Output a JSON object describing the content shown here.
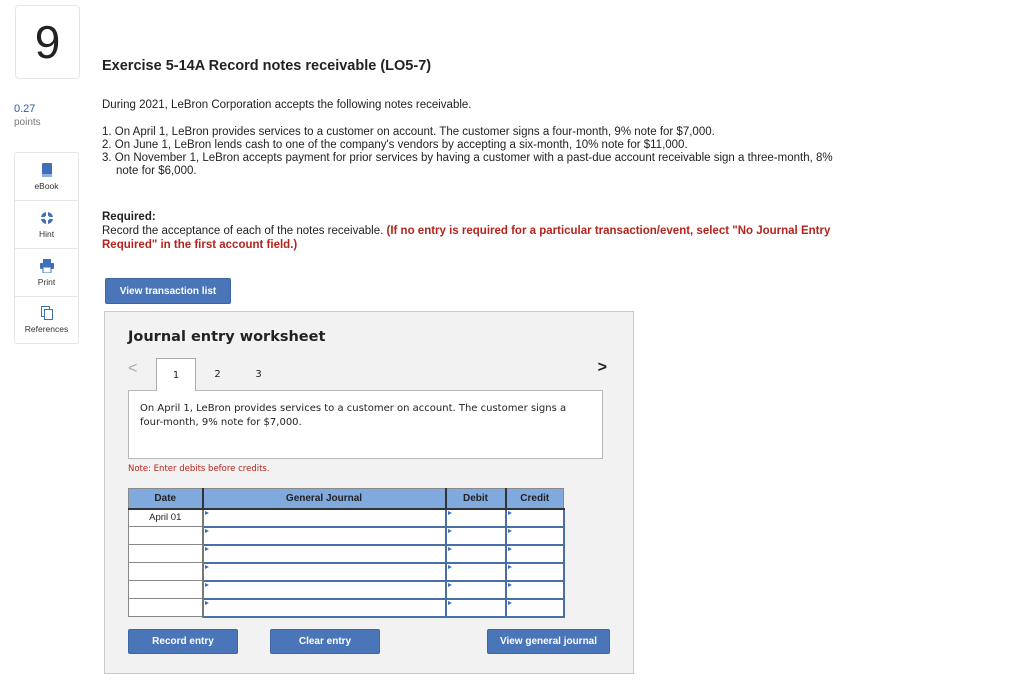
{
  "question": {
    "number": "9",
    "points_value": "0.27",
    "points_label": "points"
  },
  "tools": [
    {
      "label": "eBook",
      "icon": "book-icon"
    },
    {
      "label": "Hint",
      "icon": "lifebuoy-icon"
    },
    {
      "label": "Print",
      "icon": "printer-icon"
    },
    {
      "label": "References",
      "icon": "documents-icon"
    }
  ],
  "exercise": {
    "title": "Exercise 5-14A Record notes receivable (LO5-7)",
    "intro": "During 2021, LeBron Corporation accepts the following notes receivable.",
    "items": [
      "1. On April 1, LeBron provides services to a customer on account. The customer signs a four-month, 9% note for $7,000.",
      "2. On June 1, LeBron lends cash to one of the company's vendors by accepting a six-month, 10% note for $11,000.",
      "3. On November 1, LeBron accepts payment for prior services by having a customer with a past-due account receivable sign a three-month, 8% note for $6,000."
    ],
    "required_heading": "Required:",
    "required_text": "Record the acceptance of each of the notes receivable. ",
    "required_instruction": "(If no entry is required for a particular transaction/event, select \"No Journal Entry Required\" in the first account field.)",
    "view_transaction_list": "View transaction list"
  },
  "worksheet": {
    "title": "Journal entry worksheet",
    "prev_icon": "<",
    "next_icon": ">",
    "tabs": [
      "1",
      "2",
      "3"
    ],
    "active_tab": "1",
    "description": "On April 1, LeBron provides services to a customer on account. The customer signs a four-month, 9% note for $7,000.",
    "note": "Note: Enter debits before credits.",
    "columns": [
      "Date",
      "General Journal",
      "Debit",
      "Credit"
    ],
    "rows": [
      {
        "date": "April 01",
        "account": "",
        "debit": "",
        "credit": ""
      },
      {
        "date": "",
        "account": "",
        "debit": "",
        "credit": ""
      },
      {
        "date": "",
        "account": "",
        "debit": "",
        "credit": ""
      },
      {
        "date": "",
        "account": "",
        "debit": "",
        "credit": ""
      },
      {
        "date": "",
        "account": "",
        "debit": "",
        "credit": ""
      },
      {
        "date": "",
        "account": "",
        "debit": "",
        "credit": ""
      }
    ],
    "buttons": {
      "record": "Record entry",
      "clear": "Clear entry",
      "view_journal": "View general journal"
    }
  },
  "colors": {
    "button_blue": "#4a76b9",
    "header_blue": "#80a9de",
    "instruction_red": "#b5241c",
    "points_blue": "#2a5aa6"
  }
}
